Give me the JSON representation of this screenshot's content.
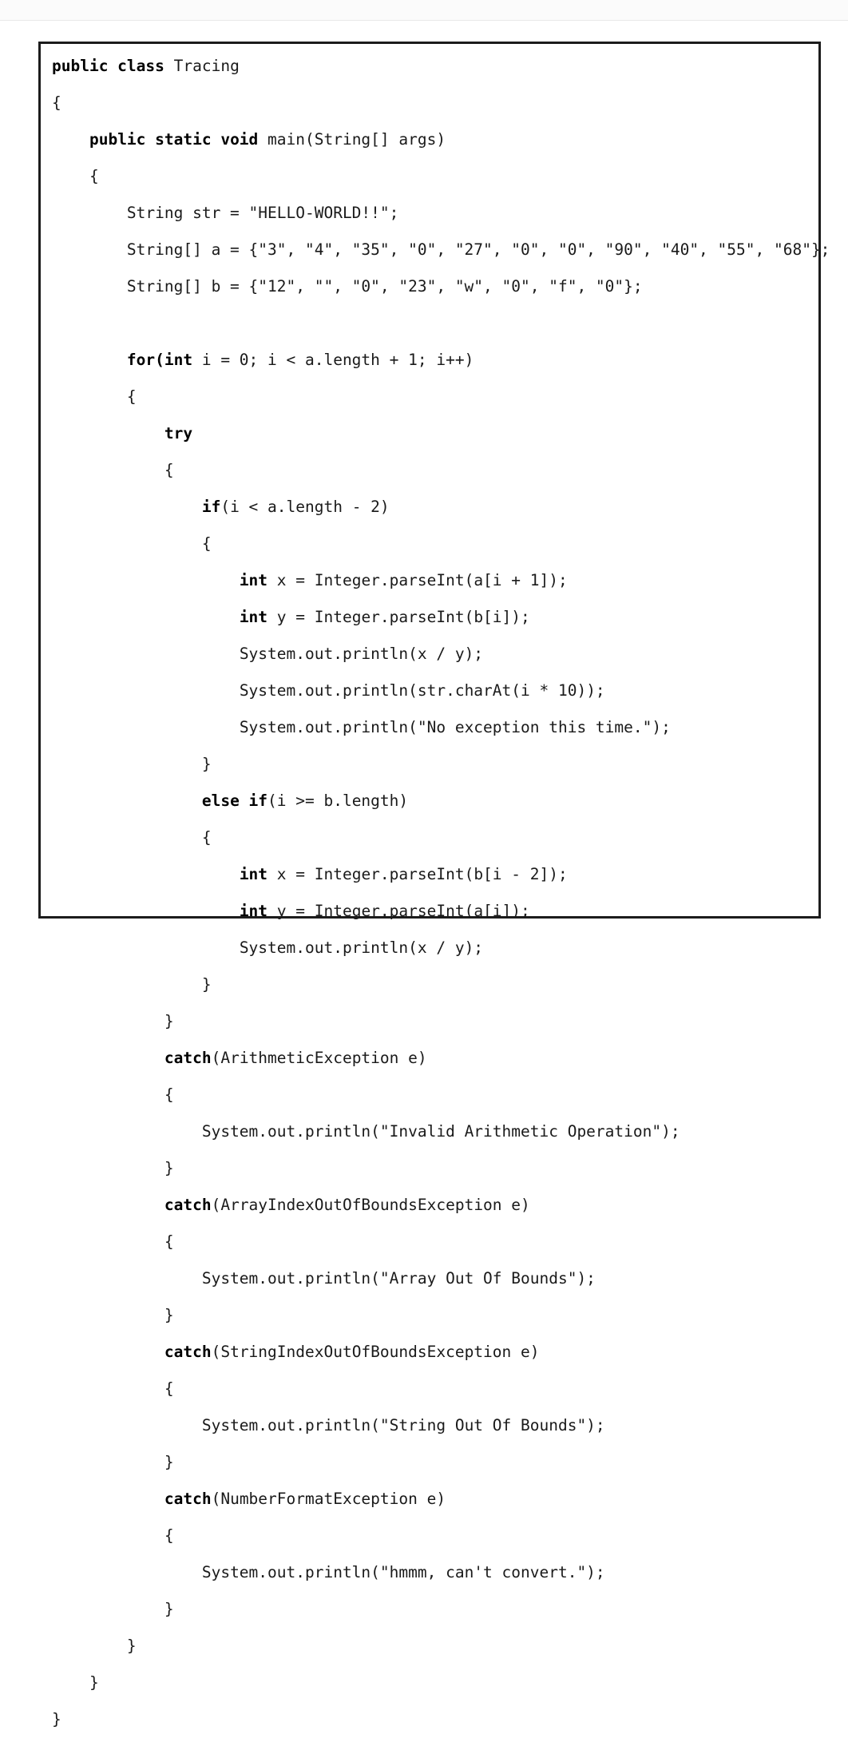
{
  "page": {
    "background_color": "#ffffff",
    "top_band_color": "#fbfbfb",
    "divider_color": "#e9e9e9",
    "ghost_text": "",
    "border_color": "#1c1c1c",
    "text_color": "#1a1a1a",
    "keyword_color": "#000000"
  },
  "code": {
    "language": "Java",
    "class_name": "Tracing",
    "lines": [
      {
        "indent": 0,
        "tokens": [
          {
            "t": "public class ",
            "b": true
          },
          {
            "t": "Tracing",
            "b": false
          }
        ]
      },
      {
        "indent": 0,
        "tokens": [
          {
            "t": "{",
            "b": false
          }
        ]
      },
      {
        "indent": 1,
        "tokens": [
          {
            "t": "public static void ",
            "b": true
          },
          {
            "t": "main(String[] args)",
            "b": false
          }
        ]
      },
      {
        "indent": 1,
        "tokens": [
          {
            "t": "{",
            "b": false
          }
        ]
      },
      {
        "indent": 2,
        "tokens": [
          {
            "t": "String str = \"HELLO-WORLD!!\";",
            "b": false
          }
        ]
      },
      {
        "indent": 2,
        "tokens": [
          {
            "t": "String[] a = {\"3\", \"4\", \"35\", \"0\", \"27\", \"0\", \"0\", \"90\", \"40\", \"55\", \"68\"};",
            "b": false
          }
        ]
      },
      {
        "indent": 2,
        "tokens": [
          {
            "t": "String[] b = {\"12\", \"\", \"0\", \"23\", \"w\", \"0\", \"f\", \"0\"};",
            "b": false
          }
        ]
      },
      {
        "indent": 0,
        "blank": true,
        "tokens": []
      },
      {
        "indent": 2,
        "tokens": [
          {
            "t": "for(int ",
            "b": true
          },
          {
            "t": "i = 0; i < a.length + 1; i++)",
            "b": false
          }
        ]
      },
      {
        "indent": 2,
        "tokens": [
          {
            "t": "{",
            "b": false
          }
        ]
      },
      {
        "indent": 3,
        "tokens": [
          {
            "t": "try",
            "b": true
          }
        ]
      },
      {
        "indent": 3,
        "tokens": [
          {
            "t": "{",
            "b": false
          }
        ]
      },
      {
        "indent": 4,
        "tokens": [
          {
            "t": "if",
            "b": true
          },
          {
            "t": "(i < a.length - 2)",
            "b": false
          }
        ]
      },
      {
        "indent": 4,
        "tokens": [
          {
            "t": "{",
            "b": false
          }
        ]
      },
      {
        "indent": 5,
        "tokens": [
          {
            "t": "int ",
            "b": true
          },
          {
            "t": "x = Integer.parseInt(a[i + 1]);",
            "b": false
          }
        ]
      },
      {
        "indent": 5,
        "tokens": [
          {
            "t": "int ",
            "b": true
          },
          {
            "t": "y = Integer.parseInt(b[i]);",
            "b": false
          }
        ]
      },
      {
        "indent": 5,
        "tokens": [
          {
            "t": "System.out.println(x / y);",
            "b": false
          }
        ]
      },
      {
        "indent": 5,
        "tokens": [
          {
            "t": "System.out.println(str.charAt(i * 10));",
            "b": false
          }
        ]
      },
      {
        "indent": 5,
        "tokens": [
          {
            "t": "System.out.println(\"No exception this time.\");",
            "b": false
          }
        ]
      },
      {
        "indent": 4,
        "tokens": [
          {
            "t": "}",
            "b": false
          }
        ]
      },
      {
        "indent": 4,
        "tokens": [
          {
            "t": "else if",
            "b": true
          },
          {
            "t": "(i >= b.length)",
            "b": false
          }
        ]
      },
      {
        "indent": 4,
        "tokens": [
          {
            "t": "{",
            "b": false
          }
        ]
      },
      {
        "indent": 5,
        "tokens": [
          {
            "t": "int ",
            "b": true
          },
          {
            "t": "x = Integer.parseInt(b[i - 2]);",
            "b": false
          }
        ]
      },
      {
        "indent": 5,
        "tokens": [
          {
            "t": "int ",
            "b": true
          },
          {
            "t": "y = Integer.parseInt(a[i]);",
            "b": false
          }
        ]
      },
      {
        "indent": 5,
        "tokens": [
          {
            "t": "System.out.println(x / y);",
            "b": false
          }
        ]
      },
      {
        "indent": 4,
        "tokens": [
          {
            "t": "}",
            "b": false
          }
        ]
      },
      {
        "indent": 3,
        "tokens": [
          {
            "t": "}",
            "b": false
          }
        ]
      },
      {
        "indent": 3,
        "tokens": [
          {
            "t": "catch",
            "b": true
          },
          {
            "t": "(ArithmeticException e)",
            "b": false
          }
        ]
      },
      {
        "indent": 3,
        "tokens": [
          {
            "t": "{",
            "b": false
          }
        ]
      },
      {
        "indent": 4,
        "tokens": [
          {
            "t": "System.out.println(\"Invalid Arithmetic Operation\");",
            "b": false
          }
        ]
      },
      {
        "indent": 3,
        "tokens": [
          {
            "t": "}",
            "b": false
          }
        ]
      },
      {
        "indent": 3,
        "tokens": [
          {
            "t": "catch",
            "b": true
          },
          {
            "t": "(ArrayIndexOutOfBoundsException e)",
            "b": false
          }
        ]
      },
      {
        "indent": 3,
        "tokens": [
          {
            "t": "{",
            "b": false
          }
        ]
      },
      {
        "indent": 4,
        "tokens": [
          {
            "t": "System.out.println(\"Array Out Of Bounds\");",
            "b": false
          }
        ]
      },
      {
        "indent": 3,
        "tokens": [
          {
            "t": "}",
            "b": false
          }
        ]
      },
      {
        "indent": 3,
        "tokens": [
          {
            "t": "catch",
            "b": true
          },
          {
            "t": "(StringIndexOutOfBoundsException e)",
            "b": false
          }
        ]
      },
      {
        "indent": 3,
        "tokens": [
          {
            "t": "{",
            "b": false
          }
        ]
      },
      {
        "indent": 4,
        "tokens": [
          {
            "t": "System.out.println(\"String Out Of Bounds\");",
            "b": false
          }
        ]
      },
      {
        "indent": 3,
        "tokens": [
          {
            "t": "}",
            "b": false
          }
        ]
      },
      {
        "indent": 3,
        "tokens": [
          {
            "t": "catch",
            "b": true
          },
          {
            "t": "(NumberFormatException e)",
            "b": false
          }
        ]
      },
      {
        "indent": 3,
        "tokens": [
          {
            "t": "{",
            "b": false
          }
        ]
      },
      {
        "indent": 4,
        "tokens": [
          {
            "t": "System.out.println(\"hmmm, can't convert.\");",
            "b": false
          }
        ]
      },
      {
        "indent": 3,
        "tokens": [
          {
            "t": "}",
            "b": false
          }
        ]
      },
      {
        "indent": 2,
        "tokens": [
          {
            "t": "}",
            "b": false
          }
        ]
      },
      {
        "indent": 1,
        "tokens": [
          {
            "t": "}",
            "b": false
          }
        ]
      },
      {
        "indent": 0,
        "tokens": [
          {
            "t": "}",
            "b": false
          }
        ]
      }
    ]
  }
}
